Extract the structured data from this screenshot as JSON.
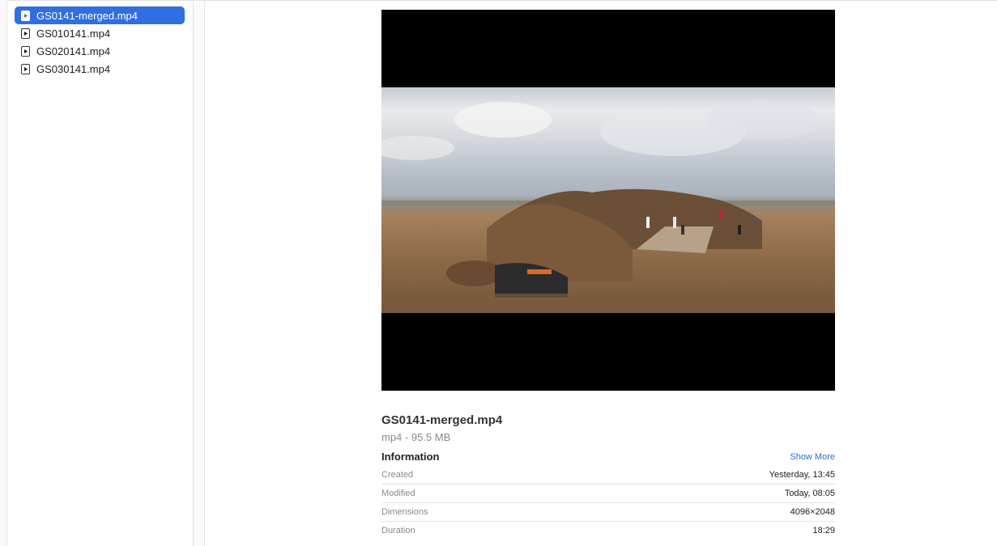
{
  "sidebar": {
    "files": [
      {
        "name": "GS0141-merged.mp4",
        "selected": true
      },
      {
        "name": "GS010141.mp4",
        "selected": false
      },
      {
        "name": "GS020141.mp4",
        "selected": false
      },
      {
        "name": "GS030141.mp4",
        "selected": false
      }
    ]
  },
  "preview": {
    "image_description": "360 panoramic video frame of a volcanic crater with visitors"
  },
  "details": {
    "filename": "GS0141-merged.mp4",
    "kind_size": "mp4 - 95.5 MB",
    "information_heading": "Information",
    "show_more_label": "Show More",
    "rows": [
      {
        "key": "Created",
        "value": "Yesterday, 13:45"
      },
      {
        "key": "Modified",
        "value": "Today, 08:05"
      },
      {
        "key": "Dimensions",
        "value": "4096×2048"
      },
      {
        "key": "Duration",
        "value": "18:29"
      }
    ]
  },
  "colors": {
    "selection": "#2f6fe0",
    "link": "#2a6cd6"
  }
}
